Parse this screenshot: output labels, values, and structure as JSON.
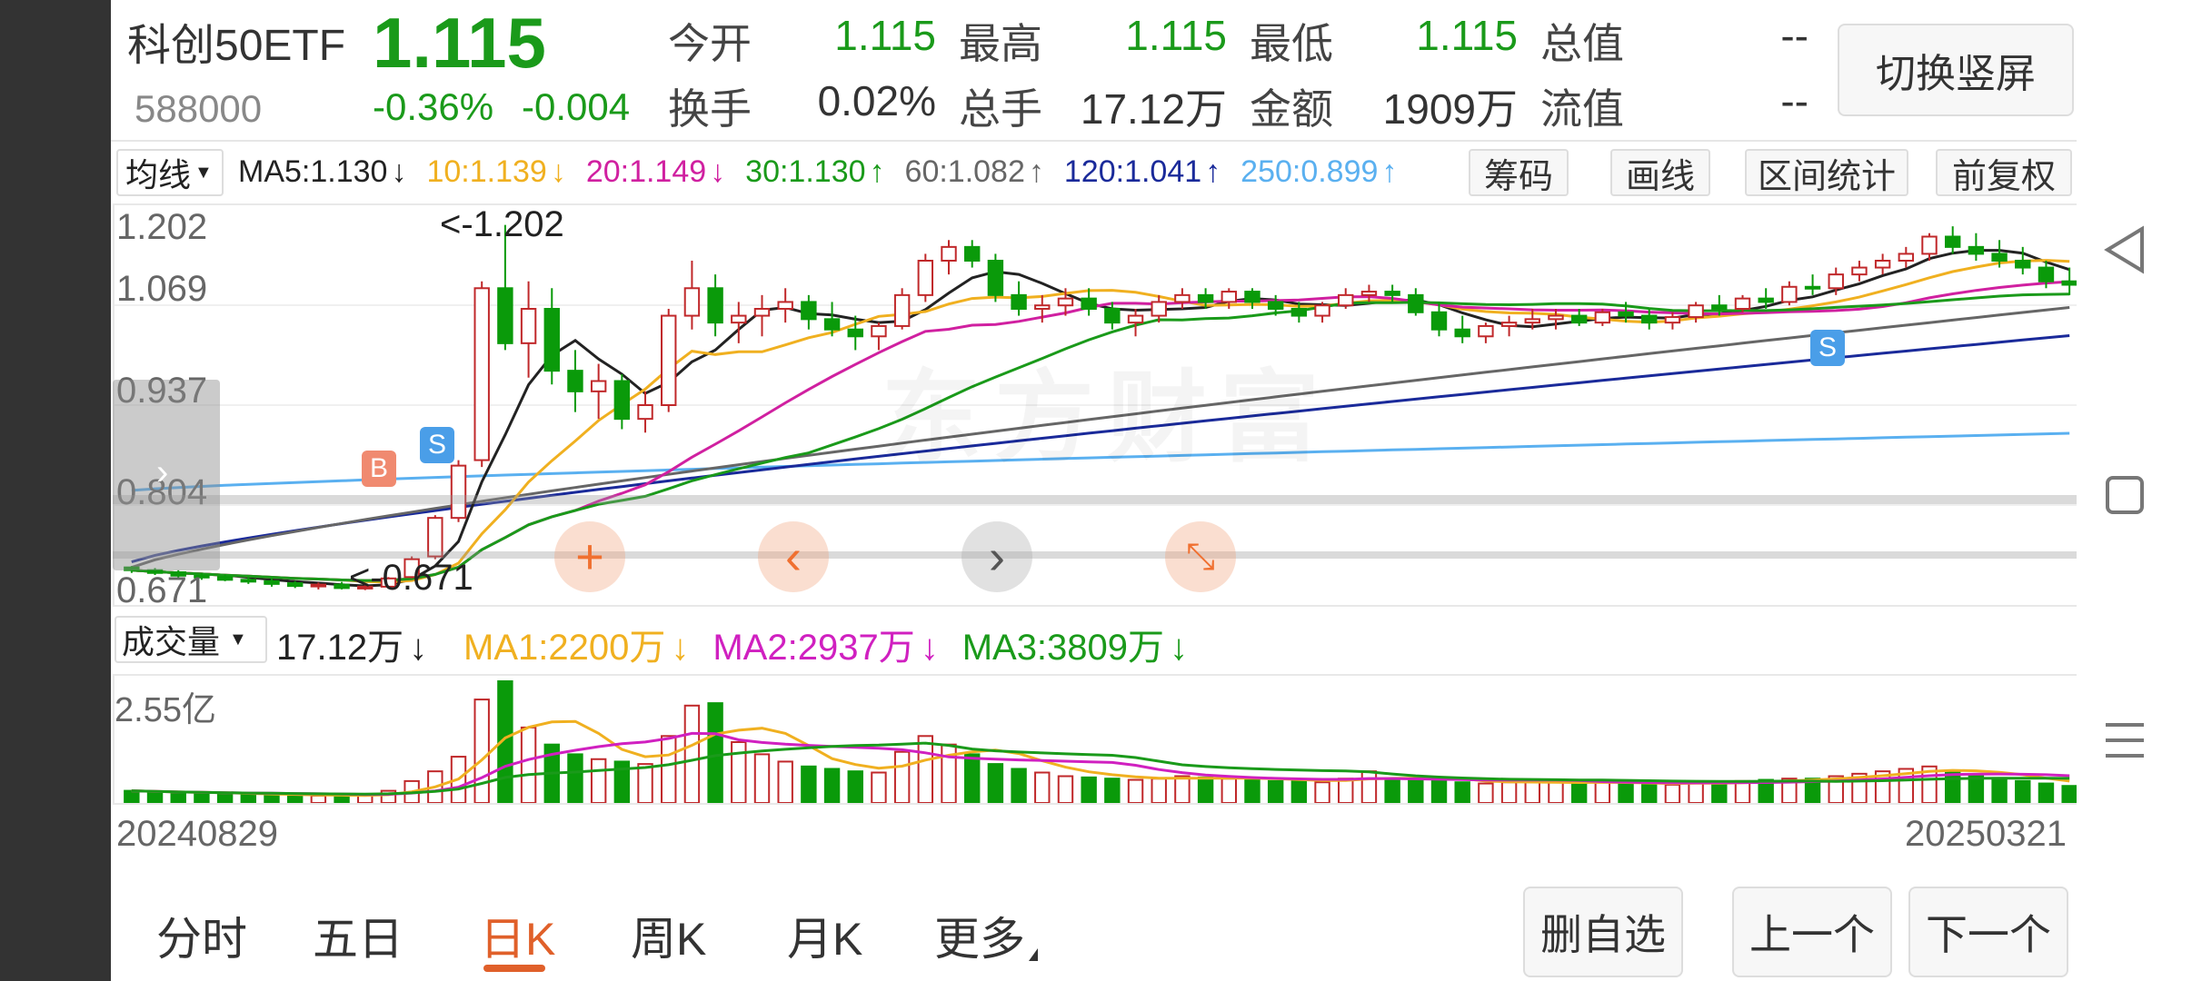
{
  "quote": {
    "name": "科创50ETF",
    "code": "588000",
    "price": "1.115",
    "change_pct": "-0.36%",
    "change": "-0.004",
    "fields": [
      {
        "label": "今开",
        "value": "1.115",
        "color": "#1a9a1a"
      },
      {
        "label": "最高",
        "value": "1.115",
        "color": "#1a9a1a"
      },
      {
        "label": "最低",
        "value": "1.115",
        "color": "#1a9a1a"
      },
      {
        "label": "总值",
        "value": "--",
        "color": "#333333"
      },
      {
        "label": "换手",
        "value": "0.02%",
        "color": "#333333"
      },
      {
        "label": "总手",
        "value": "17.12万",
        "color": "#333333"
      },
      {
        "label": "金额",
        "value": "1909万",
        "color": "#333333"
      },
      {
        "label": "流值",
        "value": "--",
        "color": "#333333"
      }
    ],
    "switch_button": "切换竖屏"
  },
  "indicator_bar": {
    "selector": "均线",
    "ma": [
      {
        "text": "MA5:1.130",
        "arrow": "↓",
        "color": "#222222"
      },
      {
        "text": "10:1.139",
        "arrow": "↓",
        "color": "#f0b020"
      },
      {
        "text": "20:1.149",
        "arrow": "↓",
        "color": "#d020a0"
      },
      {
        "text": "30:1.130",
        "arrow": "↑",
        "color": "#1a9a1a"
      },
      {
        "text": "60:1.082",
        "arrow": "↑",
        "color": "#666666"
      },
      {
        "text": "120:1.041",
        "arrow": "↑",
        "color": "#1a2a9a"
      },
      {
        "text": "250:0.899",
        "arrow": "↑",
        "color": "#5ab0f0"
      }
    ],
    "buttons": [
      "筹码",
      "画线",
      "区间统计",
      "前复权"
    ]
  },
  "price_chart": {
    "y_labels": [
      "1.202",
      "1.069",
      "0.937",
      "0.804",
      "0.671"
    ],
    "high_mark": "<-1.202",
    "low_mark": "<-0.671",
    "watermark": "东方财富",
    "signals": {
      "buy": "B",
      "sell": "S"
    }
  },
  "volume_bar": {
    "selector": "成交量",
    "value": "17.12万",
    "value_arrow": "↓",
    "ma": [
      {
        "text": "MA1:2200万",
        "arrow": "↓",
        "color": "#f0b020"
      },
      {
        "text": "MA2:2937万",
        "arrow": "↓",
        "color": "#d020c0"
      },
      {
        "text": "MA3:3809万",
        "arrow": "↓",
        "color": "#1a9a1a"
      }
    ]
  },
  "volume_chart": {
    "y_label": "2.55亿"
  },
  "dates": {
    "start": "20240829",
    "end": "20250321"
  },
  "tabs": [
    "分时",
    "五日",
    "日K",
    "周K",
    "月K",
    "更多"
  ],
  "active_tab": "日K",
  "bottom_buttons": [
    "删自选",
    "上一个",
    "下一个"
  ],
  "chart_data": {
    "type": "candlestick",
    "ohlc": [
      [
        0.704,
        0.706,
        0.696,
        0.7
      ],
      [
        0.7,
        0.703,
        0.693,
        0.696
      ],
      [
        0.697,
        0.7,
        0.688,
        0.692
      ],
      [
        0.692,
        0.696,
        0.686,
        0.69
      ],
      [
        0.69,
        0.694,
        0.684,
        0.686
      ],
      [
        0.686,
        0.69,
        0.68,
        0.684
      ],
      [
        0.684,
        0.688,
        0.676,
        0.68
      ],
      [
        0.681,
        0.684,
        0.674,
        0.677
      ],
      [
        0.677,
        0.682,
        0.672,
        0.679
      ],
      [
        0.679,
        0.683,
        0.672,
        0.674
      ],
      [
        0.674,
        0.678,
        0.671,
        0.676
      ],
      [
        0.676,
        0.69,
        0.673,
        0.688
      ],
      [
        0.69,
        0.72,
        0.688,
        0.716
      ],
      [
        0.72,
        0.78,
        0.716,
        0.776
      ],
      [
        0.776,
        0.86,
        0.77,
        0.852
      ],
      [
        0.86,
        1.12,
        0.85,
        1.11
      ],
      [
        1.11,
        1.202,
        1.02,
        1.03
      ],
      [
        1.03,
        1.12,
        0.98,
        1.08
      ],
      [
        1.08,
        1.11,
        0.97,
        0.99
      ],
      [
        0.99,
        1.02,
        0.93,
        0.96
      ],
      [
        0.96,
        1.0,
        0.92,
        0.975
      ],
      [
        0.975,
        0.985,
        0.905,
        0.92
      ],
      [
        0.92,
        0.96,
        0.9,
        0.94
      ],
      [
        0.94,
        1.08,
        0.93,
        1.07
      ],
      [
        1.07,
        1.15,
        1.05,
        1.11
      ],
      [
        1.11,
        1.13,
        1.04,
        1.06
      ],
      [
        1.06,
        1.09,
        1.03,
        1.07
      ],
      [
        1.07,
        1.1,
        1.04,
        1.08
      ],
      [
        1.08,
        1.11,
        1.06,
        1.09
      ],
      [
        1.09,
        1.1,
        1.05,
        1.065
      ],
      [
        1.065,
        1.09,
        1.04,
        1.05
      ],
      [
        1.05,
        1.07,
        1.02,
        1.04
      ],
      [
        1.04,
        1.06,
        1.02,
        1.055
      ],
      [
        1.055,
        1.11,
        1.05,
        1.1
      ],
      [
        1.1,
        1.16,
        1.09,
        1.15
      ],
      [
        1.15,
        1.18,
        1.13,
        1.17
      ],
      [
        1.17,
        1.18,
        1.14,
        1.15
      ],
      [
        1.15,
        1.16,
        1.09,
        1.1
      ],
      [
        1.1,
        1.12,
        1.07,
        1.08
      ],
      [
        1.08,
        1.1,
        1.06,
        1.085
      ],
      [
        1.085,
        1.11,
        1.07,
        1.095
      ],
      [
        1.095,
        1.11,
        1.07,
        1.08
      ],
      [
        1.08,
        1.09,
        1.05,
        1.06
      ],
      [
        1.06,
        1.08,
        1.04,
        1.07
      ],
      [
        1.07,
        1.1,
        1.06,
        1.09
      ],
      [
        1.09,
        1.11,
        1.08,
        1.1
      ],
      [
        1.1,
        1.11,
        1.08,
        1.09
      ],
      [
        1.09,
        1.11,
        1.08,
        1.105
      ],
      [
        1.105,
        1.11,
        1.08,
        1.09
      ],
      [
        1.09,
        1.1,
        1.07,
        1.08
      ],
      [
        1.08,
        1.09,
        1.06,
        1.07
      ],
      [
        1.07,
        1.09,
        1.06,
        1.085
      ],
      [
        1.085,
        1.11,
        1.08,
        1.1
      ],
      [
        1.1,
        1.115,
        1.09,
        1.105
      ],
      [
        1.105,
        1.115,
        1.09,
        1.1
      ],
      [
        1.1,
        1.11,
        1.07,
        1.075
      ],
      [
        1.075,
        1.09,
        1.04,
        1.05
      ],
      [
        1.05,
        1.07,
        1.03,
        1.04
      ],
      [
        1.04,
        1.06,
        1.03,
        1.055
      ],
      [
        1.055,
        1.07,
        1.04,
        1.06
      ],
      [
        1.06,
        1.08,
        1.05,
        1.065
      ],
      [
        1.065,
        1.08,
        1.05,
        1.07
      ],
      [
        1.07,
        1.08,
        1.055,
        1.06
      ],
      [
        1.06,
        1.08,
        1.055,
        1.075
      ],
      [
        1.075,
        1.09,
        1.06,
        1.07
      ],
      [
        1.07,
        1.08,
        1.05,
        1.06
      ],
      [
        1.06,
        1.075,
        1.05,
        1.068
      ],
      [
        1.068,
        1.09,
        1.06,
        1.085
      ],
      [
        1.085,
        1.1,
        1.07,
        1.08
      ],
      [
        1.08,
        1.1,
        1.075,
        1.095
      ],
      [
        1.095,
        1.11,
        1.08,
        1.09
      ],
      [
        1.09,
        1.12,
        1.085,
        1.112
      ],
      [
        1.112,
        1.13,
        1.1,
        1.11
      ],
      [
        1.11,
        1.14,
        1.1,
        1.13
      ],
      [
        1.13,
        1.15,
        1.12,
        1.14
      ],
      [
        1.14,
        1.16,
        1.13,
        1.15
      ],
      [
        1.15,
        1.17,
        1.14,
        1.16
      ],
      [
        1.16,
        1.19,
        1.15,
        1.185
      ],
      [
        1.185,
        1.2,
        1.16,
        1.17
      ],
      [
        1.17,
        1.19,
        1.15,
        1.16
      ],
      [
        1.16,
        1.18,
        1.14,
        1.15
      ],
      [
        1.15,
        1.17,
        1.13,
        1.14
      ],
      [
        1.14,
        1.15,
        1.11,
        1.12
      ],
      [
        1.12,
        1.14,
        1.1,
        1.115
      ]
    ],
    "volumes": [
      0.1,
      0.09,
      0.08,
      0.08,
      0.07,
      0.07,
      0.07,
      0.06,
      0.06,
      0.06,
      0.06,
      0.1,
      0.18,
      0.26,
      0.38,
      0.85,
      1.0,
      0.62,
      0.48,
      0.4,
      0.36,
      0.34,
      0.32,
      0.55,
      0.8,
      0.82,
      0.5,
      0.4,
      0.34,
      0.3,
      0.28,
      0.26,
      0.25,
      0.42,
      0.55,
      0.48,
      0.4,
      0.32,
      0.28,
      0.25,
      0.22,
      0.21,
      0.2,
      0.19,
      0.2,
      0.22,
      0.21,
      0.2,
      0.19,
      0.18,
      0.18,
      0.17,
      0.2,
      0.26,
      0.2,
      0.19,
      0.18,
      0.17,
      0.16,
      0.17,
      0.18,
      0.17,
      0.16,
      0.17,
      0.16,
      0.16,
      0.15,
      0.17,
      0.17,
      0.18,
      0.19,
      0.2,
      0.2,
      0.22,
      0.24,
      0.26,
      0.28,
      0.3,
      0.26,
      0.22,
      0.2,
      0.18,
      0.16,
      0.14
    ],
    "ma_lines": {
      "ma60_endpoints": [
        0.704,
        1.082
      ],
      "ma120_endpoints": [
        0.712,
        1.041
      ],
      "ma250_endpoints": [
        0.816,
        0.899
      ]
    },
    "ylim": [
      0.66,
      1.22
    ]
  }
}
